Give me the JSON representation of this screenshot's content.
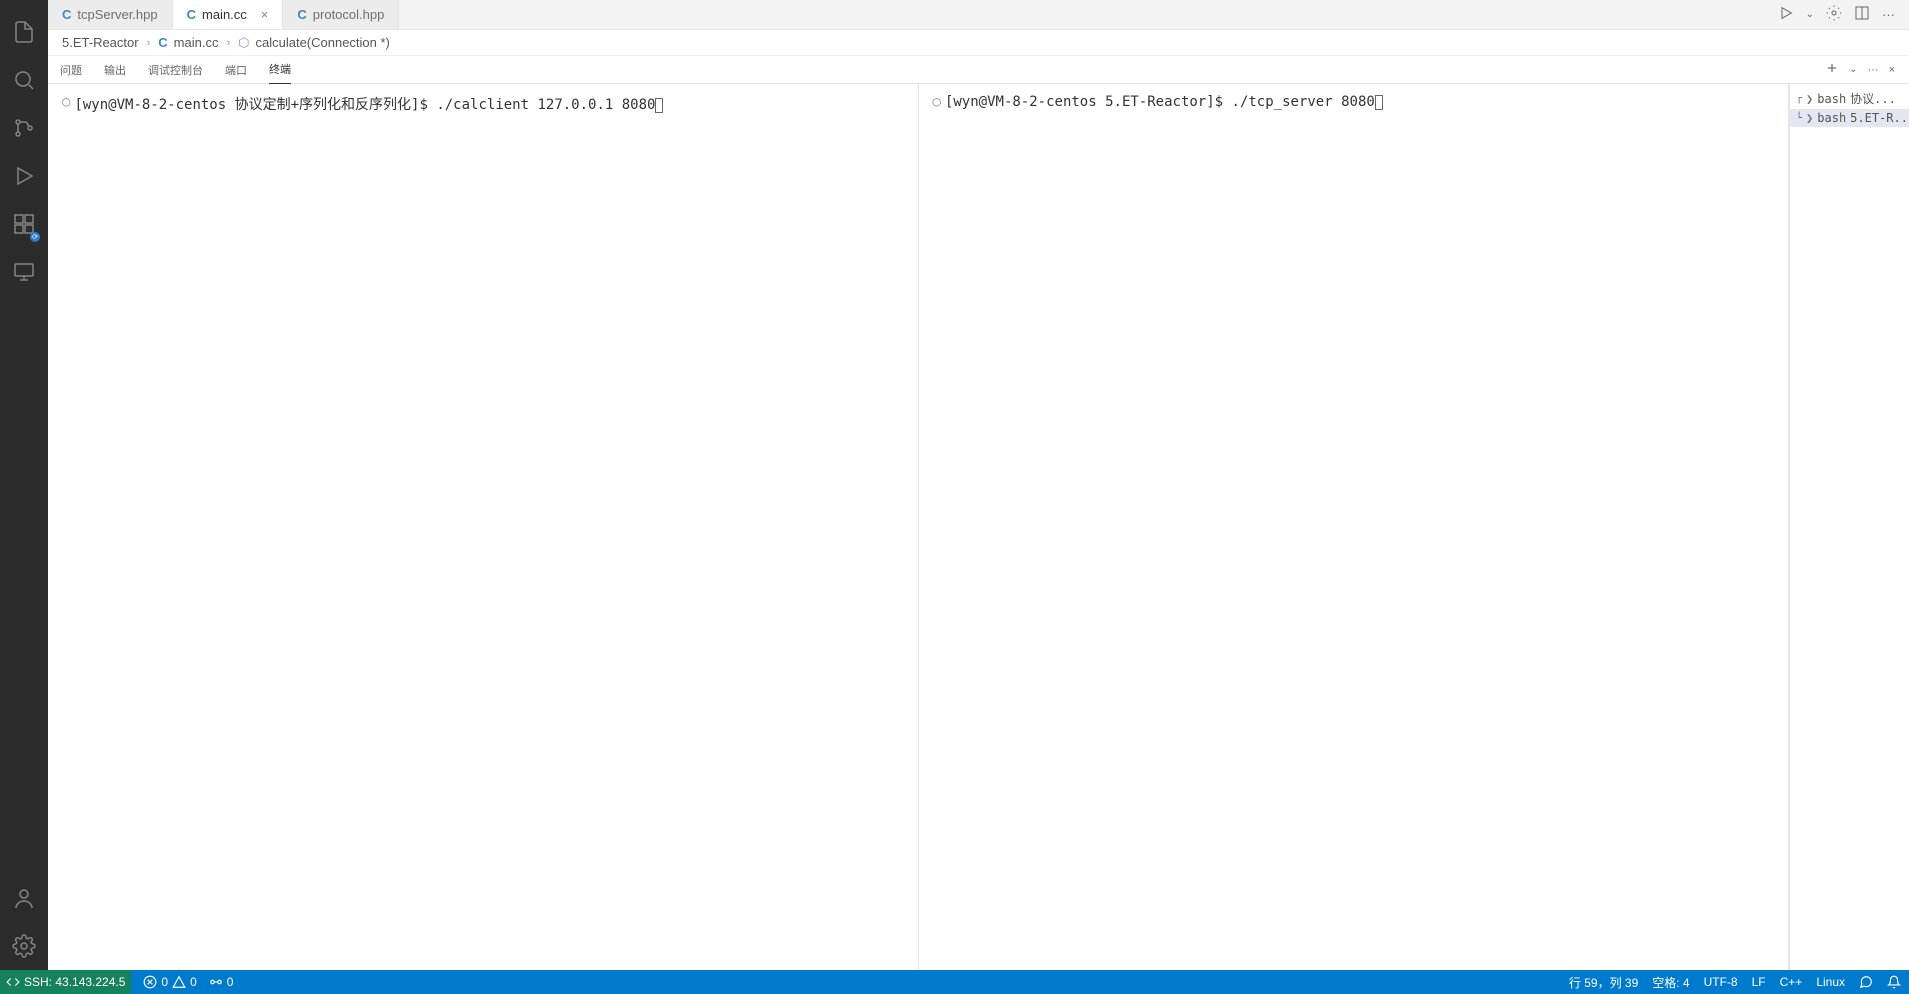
{
  "tabs": [
    {
      "icon": "C",
      "label": "tcpServer.hpp",
      "active": false,
      "close": false
    },
    {
      "icon": "C",
      "label": "main.cc",
      "active": true,
      "close": true
    },
    {
      "icon": "C",
      "label": "protocol.hpp",
      "active": false,
      "close": false
    }
  ],
  "breadcrumb": {
    "root": "5.ET-Reactor",
    "file": "main.cc",
    "symbol": "calculate(Connection *)"
  },
  "panel_tabs": {
    "problems": "问题",
    "output": "输出",
    "debug_console": "调试控制台",
    "ports": "端口",
    "terminal": "终端"
  },
  "terminals": {
    "left": {
      "prompt": "[wyn@VM-8-2-centos 协议定制+序列化和反序列化]$ ",
      "command": "./calclient 127.0.0.1 8080"
    },
    "right": {
      "prompt": "[wyn@VM-8-2-centos 5.ET-Reactor]$ ",
      "command": "./tcp_server 8080"
    },
    "sidebar": [
      {
        "prefix": "┌",
        "shell": "bash",
        "label": "协议..."
      },
      {
        "prefix": "└",
        "shell": "bash",
        "label": "5.ET-R..."
      }
    ]
  },
  "status": {
    "remote": "SSH: 43.143.224.5",
    "errors": "0",
    "warnings": "0",
    "ports": "0",
    "cursor": "行 59，列 39",
    "spaces": "空格: 4",
    "encoding": "UTF-8",
    "eol": "LF",
    "lang": "C++",
    "os": "Linux"
  }
}
